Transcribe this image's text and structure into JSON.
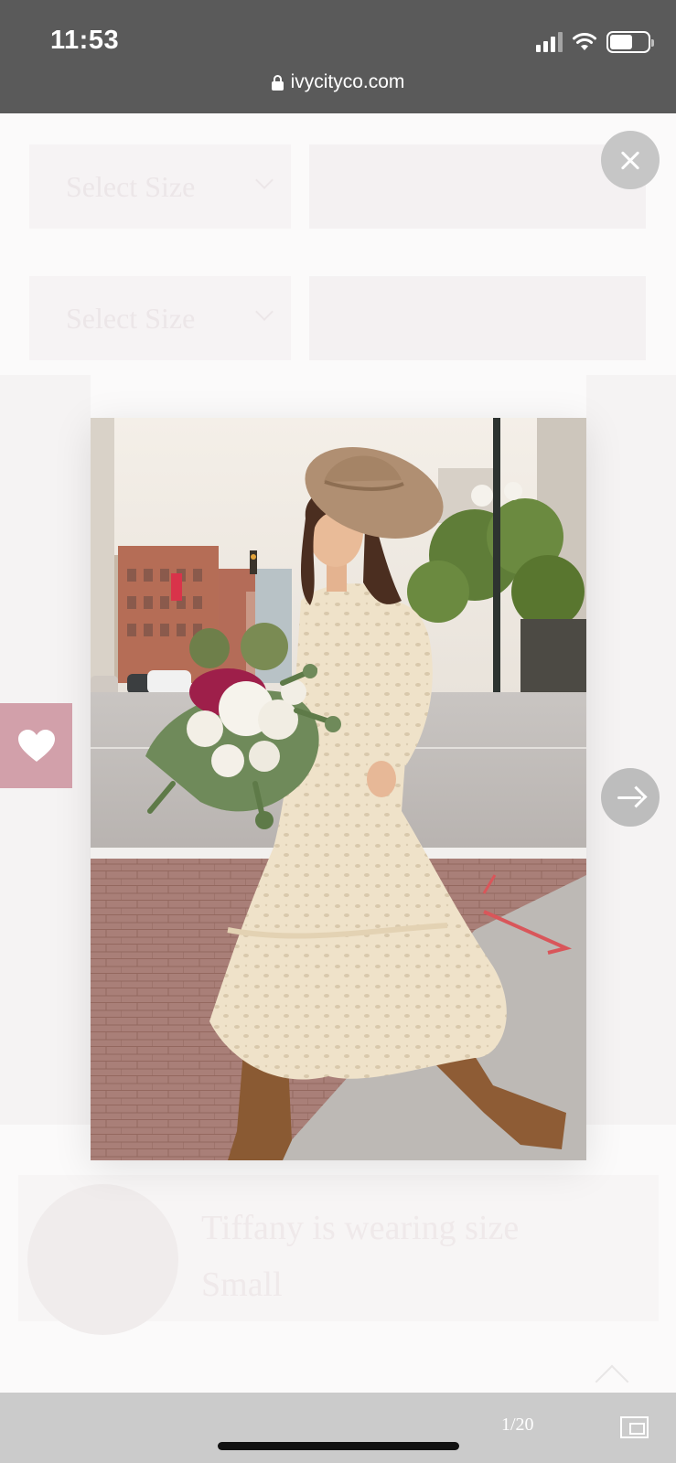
{
  "status_bar": {
    "time": "11:53"
  },
  "browser": {
    "url": "ivycityco.com"
  },
  "background_page": {
    "size_select_1": "Select Size",
    "size_select_2": "Select Size",
    "model_note": "Tiffany is wearing size Small"
  },
  "lightbox": {
    "counter": "1/20",
    "close_icon": "close-icon",
    "next_icon": "arrow-right-icon",
    "wishlist_icon": "heart-icon",
    "pip_icon": "picture-in-picture-icon"
  },
  "colors": {
    "wishlist_bg": "#d2a0aa",
    "top_bar": "#5a5a5a",
    "bottom_bar": "#cbcbcb"
  }
}
